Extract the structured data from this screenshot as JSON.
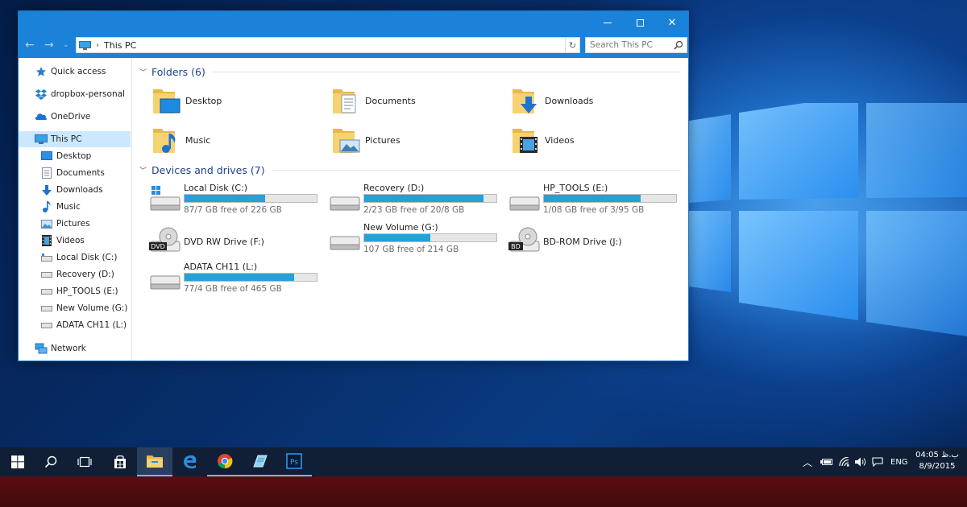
{
  "window": {
    "address": "This PC",
    "search_placeholder": "Search This PC"
  },
  "sidebar": {
    "items": [
      {
        "label": "Quick access",
        "icon": "star-icon"
      },
      {
        "label": "dropbox-personal",
        "icon": "dropbox-icon"
      },
      {
        "label": "OneDrive",
        "icon": "cloud-icon"
      },
      {
        "label": "This PC",
        "icon": "computer-icon"
      },
      {
        "label": "Desktop",
        "icon": "desktop-folder-icon"
      },
      {
        "label": "Documents",
        "icon": "documents-folder-icon"
      },
      {
        "label": "Downloads",
        "icon": "download-arrow-icon"
      },
      {
        "label": "Music",
        "icon": "music-note-icon"
      },
      {
        "label": "Pictures",
        "icon": "pictures-icon"
      },
      {
        "label": "Videos",
        "icon": "video-film-icon"
      },
      {
        "label": "Local Disk (C:)",
        "icon": "drive-icon"
      },
      {
        "label": "Recovery (D:)",
        "icon": "drive-icon"
      },
      {
        "label": "HP_TOOLS (E:)",
        "icon": "drive-icon"
      },
      {
        "label": "New Volume (G:)",
        "icon": "drive-icon"
      },
      {
        "label": "ADATA CH11 (L:)",
        "icon": "drive-icon"
      },
      {
        "label": "Network",
        "icon": "network-icon"
      }
    ]
  },
  "folders": {
    "header": "Folders (6)",
    "items": [
      {
        "label": "Desktop",
        "icon": "desktop-folder-icon"
      },
      {
        "label": "Documents",
        "icon": "documents-folder-icon"
      },
      {
        "label": "Downloads",
        "icon": "downloads-folder-icon"
      },
      {
        "label": "Music",
        "icon": "music-folder-icon"
      },
      {
        "label": "Pictures",
        "icon": "pictures-folder-icon"
      },
      {
        "label": "Videos",
        "icon": "videos-folder-icon"
      }
    ]
  },
  "drives": {
    "header": "Devices and drives (7)",
    "items": [
      {
        "name": "Local Disk (C:)",
        "free": "87/7 GB free of 226 GB",
        "used_fraction": 0.61,
        "icon": "windows-drive-icon"
      },
      {
        "name": "Recovery (D:)",
        "free": "2/23 GB free of 20/8 GB",
        "used_fraction": 0.9,
        "icon": "hard-drive-icon"
      },
      {
        "name": "HP_TOOLS (E:)",
        "free": "1/08 GB free of 3/95 GB",
        "used_fraction": 0.73,
        "icon": "hard-drive-icon"
      },
      {
        "name": "DVD RW Drive (F:)",
        "free": "",
        "used_fraction": null,
        "icon": "dvd-drive-icon",
        "badge": "DVD"
      },
      {
        "name": "New Volume (G:)",
        "free": "107 GB free of 214 GB",
        "used_fraction": 0.5,
        "icon": "hard-drive-icon"
      },
      {
        "name": "BD-ROM Drive (J:)",
        "free": "",
        "used_fraction": null,
        "icon": "bd-drive-icon",
        "badge": "BD"
      },
      {
        "name": "ADATA CH11 (L:)",
        "free": "77/4 GB free of 465 GB",
        "used_fraction": 0.83,
        "icon": "hard-drive-icon"
      }
    ]
  },
  "tray": {
    "language": "ENG",
    "time": "04:05 ب.ظ",
    "date": "8/9/2015"
  },
  "colors": {
    "titlebar": "#1b82d9",
    "selection": "#cce8ff",
    "drive_bar": "#26a0da",
    "group_title": "#1e3f8a",
    "taskbar": "#101f35"
  }
}
